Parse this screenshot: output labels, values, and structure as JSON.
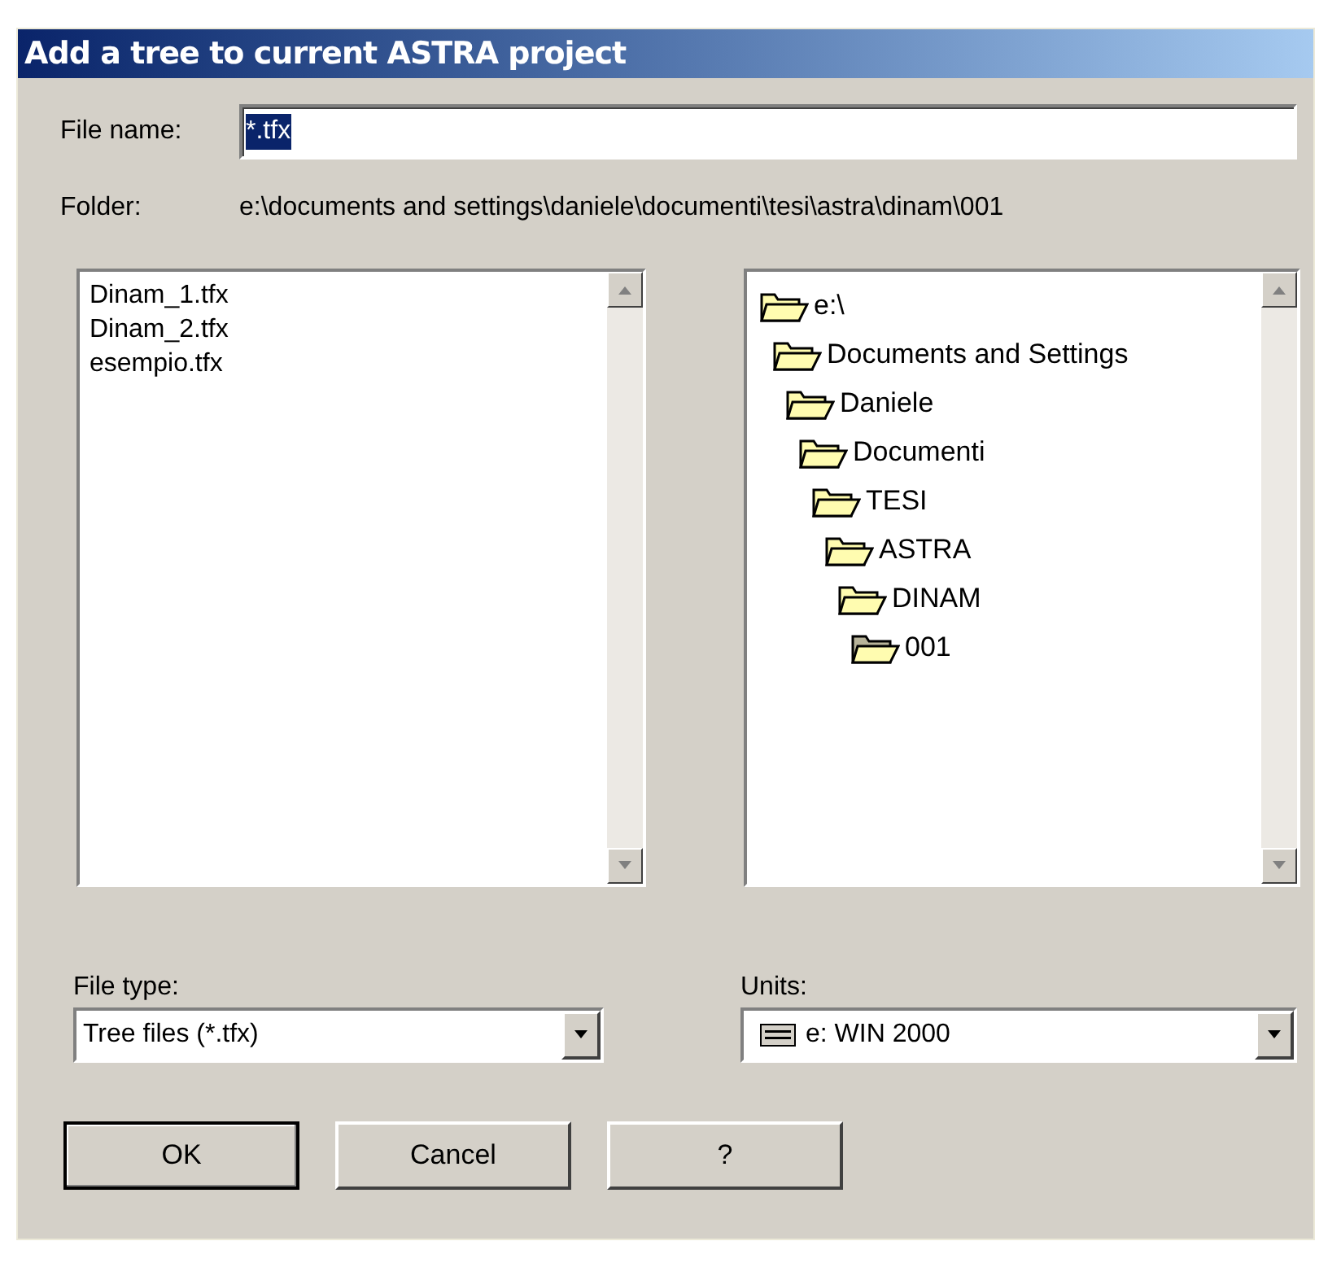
{
  "window": {
    "title": "Add a tree to current ASTRA project"
  },
  "file_name": {
    "label": "File name:",
    "value": "*.tfx"
  },
  "folder": {
    "label": "Folder:",
    "path": "e:\\documents and settings\\daniele\\documenti\\tesi\\astra\\dinam\\001"
  },
  "files": [
    "Dinam_1.tfx",
    "Dinam_2.tfx",
    "esempio.tfx"
  ],
  "folders": [
    {
      "label": "e:\\",
      "selected": false,
      "children": [
        {
          "label": "Documents and Settings",
          "selected": false,
          "children": [
            {
              "label": "Daniele",
              "selected": false,
              "children": [
                {
                  "label": "Documenti",
                  "selected": false,
                  "children": [
                    {
                      "label": "TESI",
                      "selected": false,
                      "children": [
                        {
                          "label": "ASTRA",
                          "selected": false,
                          "children": [
                            {
                              "label": "DINAM",
                              "selected": false,
                              "children": [
                                {
                                  "label": "001",
                                  "selected": true
                                }
                              ]
                            }
                          ]
                        }
                      ]
                    }
                  ]
                }
              ]
            }
          ]
        }
      ]
    }
  ],
  "file_type": {
    "label": "File type:",
    "value": "Tree files (*.tfx)"
  },
  "units": {
    "label": "Units:",
    "value": "e: WIN 2000"
  },
  "buttons": [
    {
      "label": "OK",
      "default": true
    },
    {
      "label": "Cancel",
      "default": false
    },
    {
      "label": "?",
      "default": false
    }
  ]
}
